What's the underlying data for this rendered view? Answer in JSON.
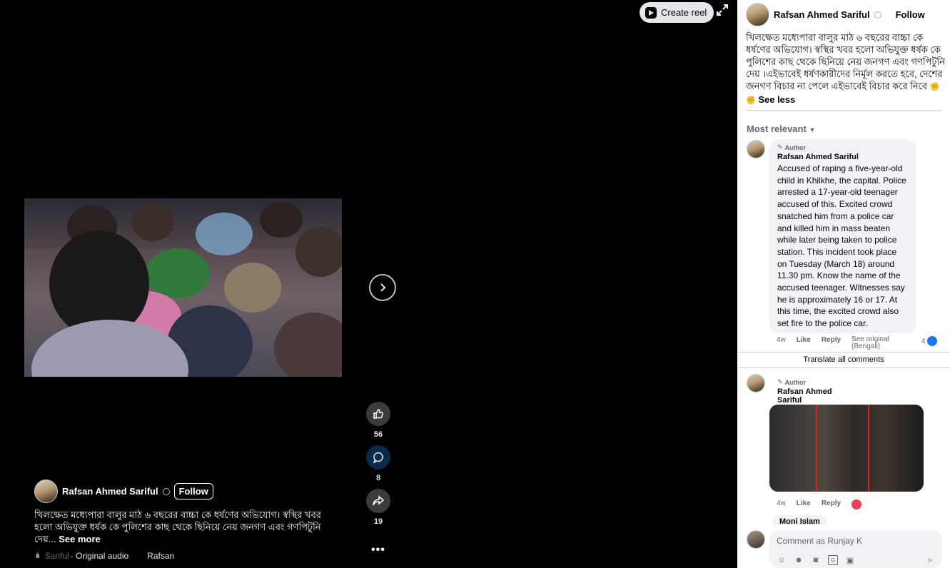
{
  "video": {
    "create_reel_label": "Create reel",
    "reactions": [
      {
        "icon": "like-icon",
        "count": "56"
      },
      {
        "icon": "comment-icon",
        "count": "8"
      },
      {
        "icon": "share-icon",
        "count": "19"
      }
    ],
    "overlay": {
      "author": "Rafsan Ahmed Sariful",
      "follow_label": "Follow",
      "caption": "খিলক্ষেত মধ্যেপারা বালুর মাঠ ৬ বছরের বাচ্চা কে ধর্ষণের অভিযোগ।  স্বস্থির খবর হলো অভিযুক্ত ধর্ষক কে  পুলিশের কাছ থেকে ছিনিয়ে নেয় জনগণ এবং গণপিটুনি দেয়...",
      "see_more_label": "See more",
      "audio_prefix": "Sariful",
      "audio_label": "· Original audio",
      "audio_user": "Rafsan"
    }
  },
  "panel": {
    "author": "Rafsan Ahmed Sariful",
    "follow_label": "Follow",
    "post_text": "খিলক্ষেত মধ্যেপারা বালুর মাঠ ৬ বছরের বাচ্চা কে ধর্ষণের অভিযোগ।  স্বস্থির খবর হলো অভিযুক্ত ধর্ষক কে  পুলিশের কাছ থেকে ছিনিয়ে নেয় জনগণ এবং গণপিটুনি দেয় ।এইভাবেই ধর্ষণকারীদের নির্মূল করতে হবে, দেশের জনগণ বিচার না পেলে এইভাবেই বিচার করে নিবে",
    "post_emoji": "✊ ✊",
    "see_less_label": "See less",
    "sort_label": "Most relevant",
    "comments": [
      {
        "author_tag": "Author",
        "name": "Rafsan Ahmed Sariful",
        "text": "Accused of raping a five-year-old child in Khilkhe, the capital. Police arrested a 17-year-old teenager accused of this. Excited crowd snatched him from a police car and killed him in mass beaten while later being taken to police station. This incident took place on Tuesday (March 18) around 11.30 pm. Know the name of the accused teenager. Witnesses say he is approximately 16 or 17. At this time, the excited crowd also set fire to the police car.",
        "time": "4w",
        "like_label": "Like",
        "reply_label": "Reply",
        "see_original_label": "See original (Bengali)",
        "reaction_count": "4"
      },
      {
        "author_tag": "Author",
        "name": "Rafsan Ahmed Sariful",
        "time": "4w",
        "like_label": "Like",
        "reply_label": "Reply"
      }
    ],
    "translate_all_label": "Translate all comments",
    "next_commenter": "Moni Islam",
    "composer_placeholder": "Comment as Runjay K"
  }
}
